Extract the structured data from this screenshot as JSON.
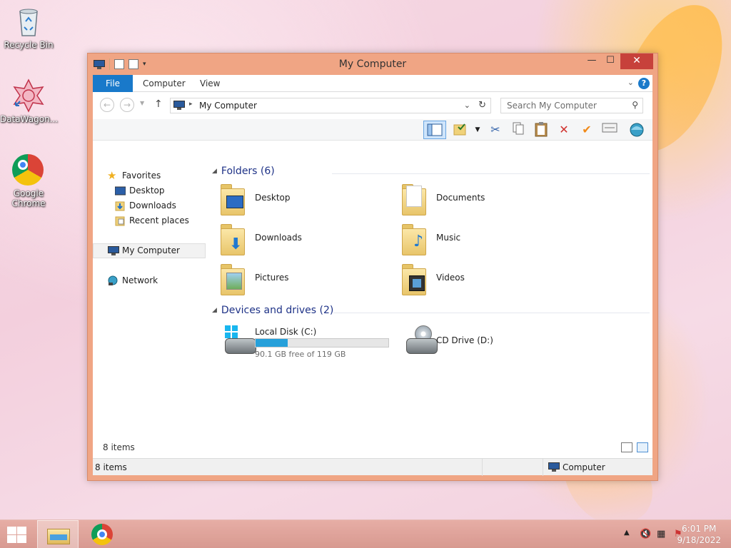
{
  "desktop": {
    "icons": [
      {
        "label": "Recycle Bin",
        "icon": "recycle-bin-icon"
      },
      {
        "label": "DataWagon...",
        "icon": "datawagon-icon"
      },
      {
        "label": "Google Chrome",
        "icon": "chrome-icon"
      }
    ]
  },
  "window": {
    "title": "My Computer",
    "controls": {
      "minimize": "—",
      "maximize": "☐",
      "close": "✕"
    },
    "ribbon": {
      "tabs": [
        "File",
        "Computer",
        "View"
      ],
      "help": "?"
    },
    "address": {
      "path": "My Computer",
      "search_placeholder": "Search My Computer"
    },
    "nav_pane": {
      "favorites_label": "Favorites",
      "favorites": [
        "Desktop",
        "Downloads",
        "Recent places"
      ],
      "my_computer": "My Computer",
      "network": "Network"
    },
    "content": {
      "folders_header": "Folders (6)",
      "folders": [
        {
          "name": "Desktop",
          "icon": "desktop-folder-icon"
        },
        {
          "name": "Documents",
          "icon": "documents-folder-icon"
        },
        {
          "name": "Downloads",
          "icon": "downloads-folder-icon"
        },
        {
          "name": "Music",
          "icon": "music-folder-icon"
        },
        {
          "name": "Pictures",
          "icon": "pictures-folder-icon"
        },
        {
          "name": "Videos",
          "icon": "videos-folder-icon"
        }
      ],
      "devices_header": "Devices and drives (2)",
      "drives": [
        {
          "name": "Local Disk (C:)",
          "free_text": "90.1 GB free of 119 GB",
          "used_fraction": 0.243,
          "icon": "hard-drive-icon"
        },
        {
          "name": "CD Drive (D:)",
          "icon": "cd-drive-icon"
        }
      ],
      "item_count": "8 items"
    },
    "status": {
      "left": "8 items",
      "right": "Computer"
    }
  },
  "taskbar": {
    "time": "6:01 PM",
    "date": "9/18/2022",
    "tray_icons": [
      "show-hidden-icons",
      "volume-muted-icon",
      "network-icon",
      "action-center-icon"
    ]
  },
  "colors": {
    "ribbon_file": "#1979ca",
    "window_frame": "#f0a584",
    "close_button": "#c7413b",
    "drive_bar": "#26a0da"
  }
}
